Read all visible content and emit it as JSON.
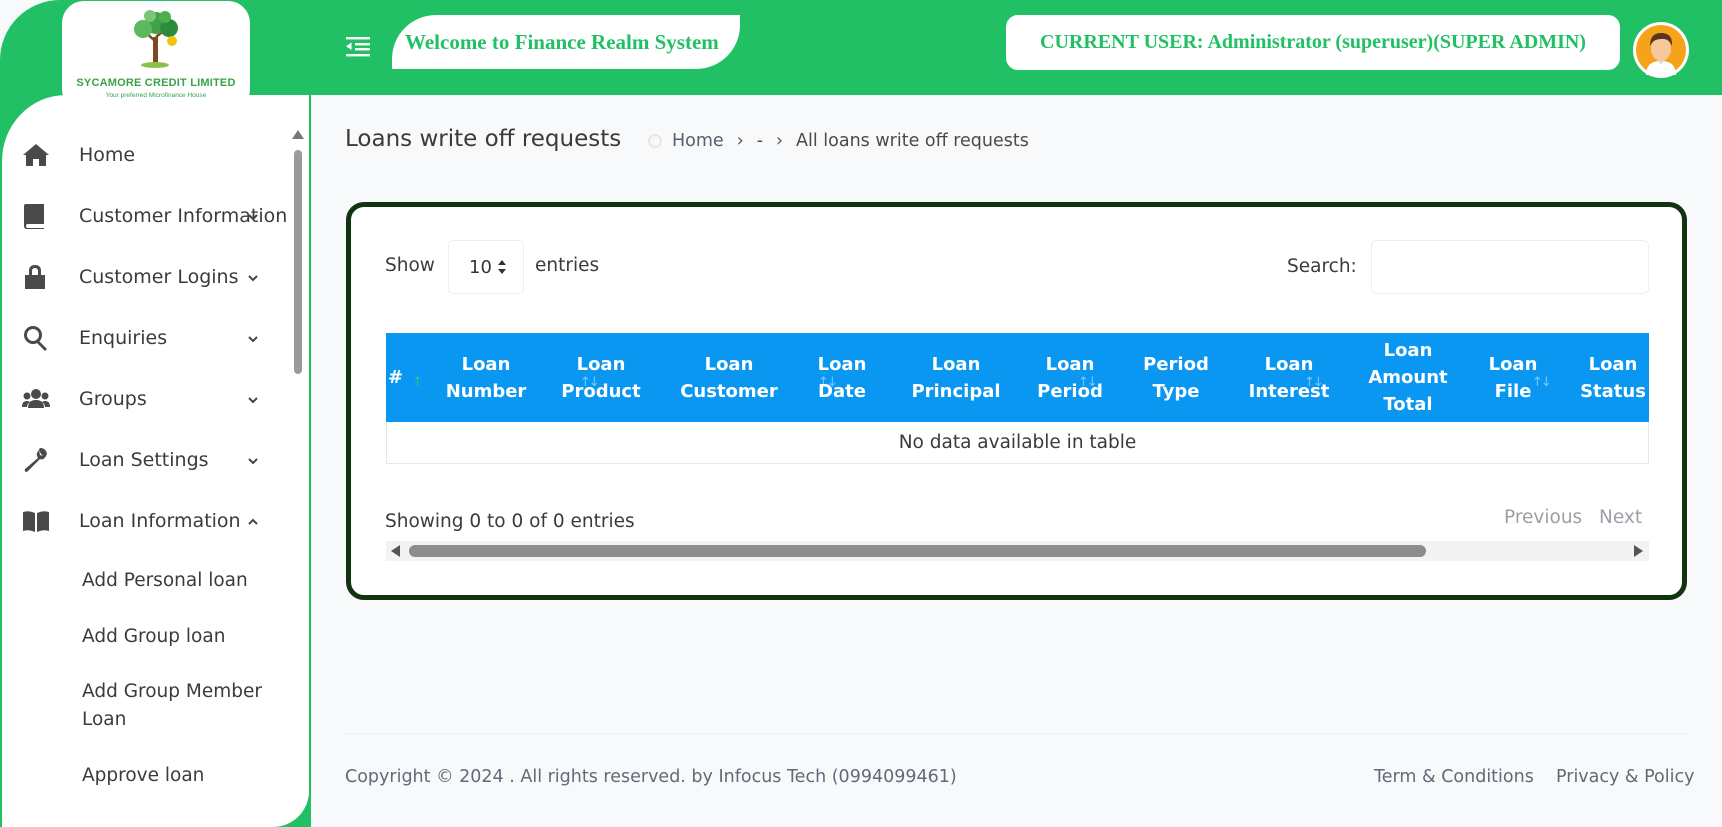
{
  "brand": {
    "logo_name": "SYCAMORE CREDIT LIMITED",
    "logo_tagline": "Your preferred Microfinance House",
    "green": "#22c065",
    "table_header_blue": "#0a97f2",
    "card_border": "#12330f"
  },
  "header": {
    "welcome": "Welcome to Finance Realm System",
    "current_user": "CURRENT USER: Administrator (superuser)(SUPER ADMIN)"
  },
  "sidebar": {
    "items": [
      {
        "label": "Home",
        "icon": "home-icon"
      },
      {
        "label": "Customer Information",
        "icon": "book-icon"
      },
      {
        "label": "Customer Logins",
        "icon": "lock-icon"
      },
      {
        "label": "Enquiries",
        "icon": "search-icon"
      },
      {
        "label": "Groups",
        "icon": "users-icon"
      },
      {
        "label": "Loan Settings",
        "icon": "wrench-icon"
      },
      {
        "label": "Loan Information",
        "icon": "open-book-icon"
      }
    ],
    "sub_items": [
      "Add Personal loan",
      "Add Group loan",
      "Add Group Member Loan",
      "Approve loan"
    ]
  },
  "page": {
    "title": "Loans write off requests",
    "breadcrumb": [
      "Home",
      "-",
      "All loans write off requests"
    ]
  },
  "table": {
    "show_label": "Show",
    "page_length": "10",
    "entries_label": "entries",
    "search_label": "Search:",
    "search_value": "",
    "columns": [
      "#",
      "Loan Number",
      "Loan Product",
      "Loan Customer",
      "Loan Date",
      "Loan Principal",
      "Loan Period",
      "Period Type",
      "Loan Interest",
      "Loan Amount Total",
      "Loan File",
      "Loan Status"
    ],
    "empty_message": "No data available in table",
    "info": "Showing 0 to 0 of 0 entries",
    "prev_label": "Previous",
    "next_label": "Next"
  },
  "footer": {
    "copyright": "Copyright © 2024 . All rights reserved. by Infocus Tech (0994099461)",
    "terms": "Term & Conditions",
    "privacy": "Privacy & Policy"
  }
}
